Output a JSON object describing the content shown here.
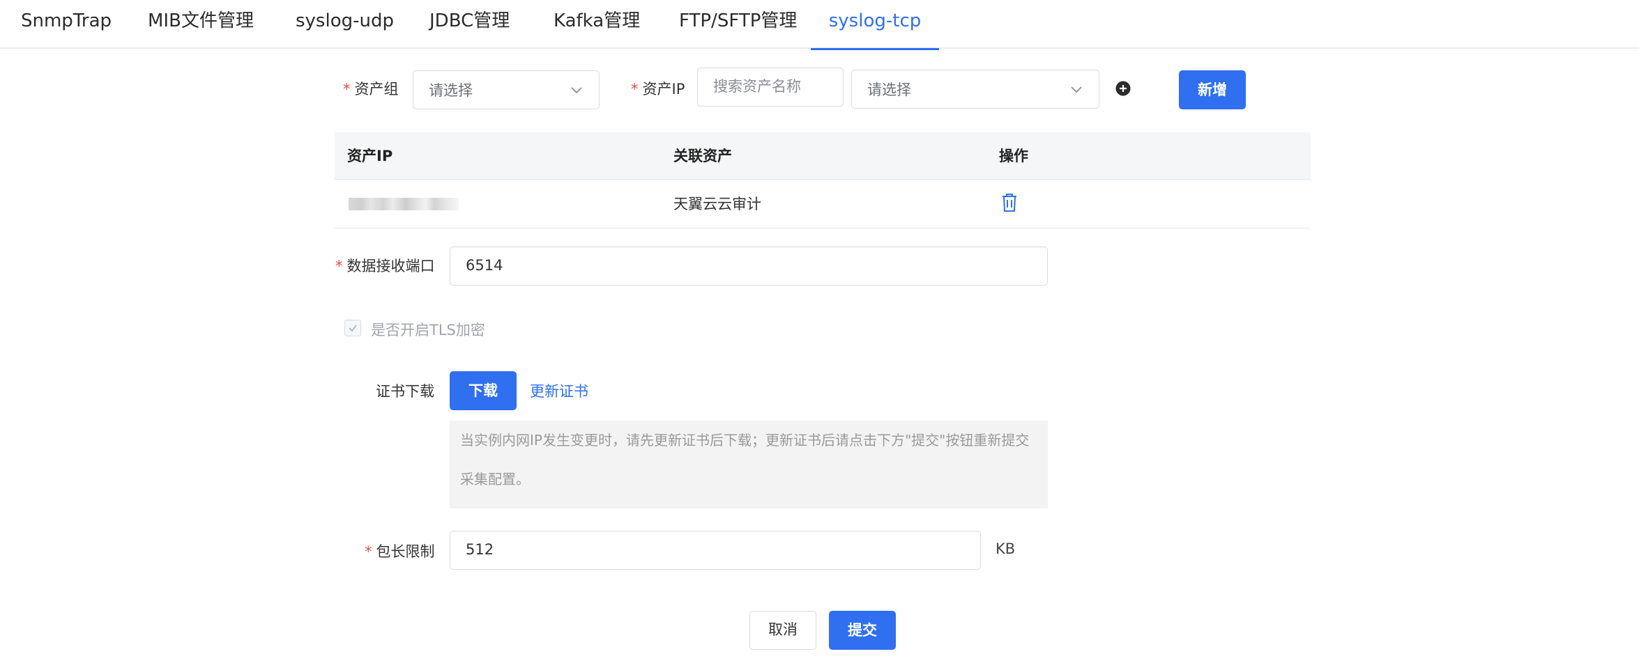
{
  "tabs": [
    {
      "label": "SnmpTrap"
    },
    {
      "label": "MIB文件管理"
    },
    {
      "label": "syslog-udp"
    },
    {
      "label": "JDBC管理"
    },
    {
      "label": "Kafka管理"
    },
    {
      "label": "FTP/SFTP管理"
    },
    {
      "label": "syslog-tcp"
    }
  ],
  "active_tab": "syslog-tcp",
  "form": {
    "required_mark": "*",
    "asset_group": {
      "label": "资产组",
      "placeholder": "请选择"
    },
    "asset_ip": {
      "label": "资产IP",
      "search_placeholder": "搜索资产名称",
      "select_placeholder": "请选择"
    },
    "add_button": "新增",
    "table": {
      "headers": [
        "资产IP",
        "关联资产",
        "操作"
      ],
      "rows": [
        {
          "ip": "",
          "asset": "天翼云云审计"
        }
      ]
    },
    "port": {
      "label": "数据接收端口",
      "value": "6514"
    },
    "tls": {
      "label": "是否开启TLS加密",
      "checked": true
    },
    "cert": {
      "label": "证书下载",
      "download_button": "下载",
      "update_link": "更新证书"
    },
    "info_text": "当实例内网IP发生变更时，请先更新证书后下载；更新证书后请点击下方\"提交\"按钮重新提交采集配置。",
    "packet": {
      "label": "包长限制",
      "value": "512",
      "unit": "KB"
    },
    "cancel_button": "取消",
    "submit_button": "提交"
  },
  "colors": {
    "accent": "#2f6ff0",
    "required": "#f04a4a"
  }
}
